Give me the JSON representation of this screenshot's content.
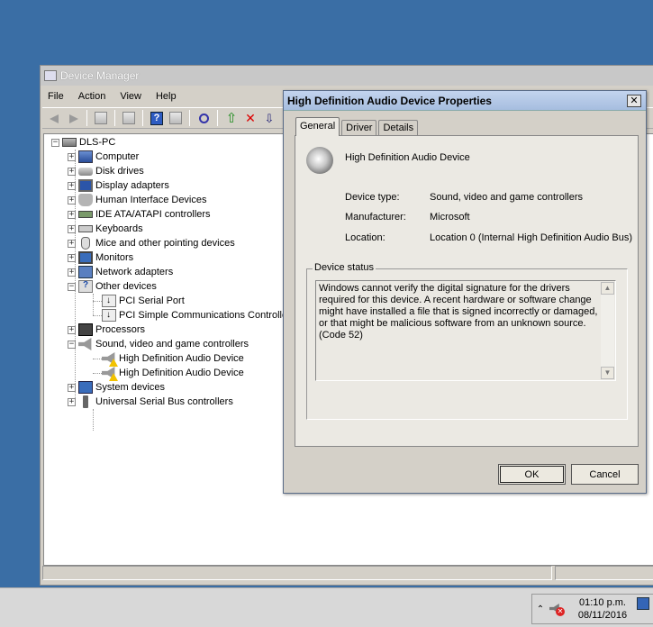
{
  "device_manager": {
    "title": "Device Manager",
    "menu": [
      "File",
      "Action",
      "View",
      "Help"
    ],
    "tree": {
      "root": "DLS-PC",
      "categories": [
        {
          "label": "Computer",
          "icon": "computer-icon",
          "expanded": false
        },
        {
          "label": "Disk drives",
          "icon": "disk-drive-icon",
          "expanded": false
        },
        {
          "label": "Display adapters",
          "icon": "display-adapter-icon",
          "expanded": false
        },
        {
          "label": "Human Interface Devices",
          "icon": "hid-icon",
          "expanded": false
        },
        {
          "label": "IDE ATA/ATAPI controllers",
          "icon": "ide-controller-icon",
          "expanded": false
        },
        {
          "label": "Keyboards",
          "icon": "keyboard-icon",
          "expanded": false
        },
        {
          "label": "Mice and other pointing devices",
          "icon": "mouse-icon",
          "expanded": false
        },
        {
          "label": "Monitors",
          "icon": "monitor-icon",
          "expanded": false
        },
        {
          "label": "Network adapters",
          "icon": "network-adapter-icon",
          "expanded": false
        },
        {
          "label": "Other devices",
          "icon": "other-devices-icon",
          "expanded": true,
          "children": [
            "PCI Serial Port",
            "PCI Simple Communications Controller"
          ]
        },
        {
          "label": "Processors",
          "icon": "processor-icon",
          "expanded": false
        },
        {
          "label": "Sound, video and game controllers",
          "icon": "sound-icon",
          "expanded": true,
          "children": [
            "High Definition Audio Device",
            "High Definition Audio Device"
          ]
        },
        {
          "label": "System devices",
          "icon": "system-devices-icon",
          "expanded": false
        },
        {
          "label": "Universal Serial Bus controllers",
          "icon": "usb-icon",
          "expanded": false
        }
      ]
    }
  },
  "dialog": {
    "title": "High Definition Audio Device Properties",
    "close_glyph": "✕",
    "tabs": [
      "General",
      "Driver",
      "Details"
    ],
    "active_tab": "General",
    "device_name": "High Definition Audio Device",
    "fields": [
      {
        "label": "Device type:",
        "value": "Sound, video and game controllers"
      },
      {
        "label": "Manufacturer:",
        "value": "Microsoft"
      },
      {
        "label": "Location:",
        "value": "Location 0 (Internal High Definition Audio Bus)"
      }
    ],
    "status_legend": "Device status",
    "status_text": "Windows cannot verify the digital signature for the drivers required for this device. A recent hardware or software change might have installed a file that is signed incorrectly or damaged, or that might be malicious software from an unknown source. (Code 52)",
    "ok_label": "OK",
    "cancel_label": "Cancel"
  },
  "taskbar": {
    "time": "01:10 p.m.",
    "date": "08/11/2016",
    "tray_chevron": "⌃"
  }
}
